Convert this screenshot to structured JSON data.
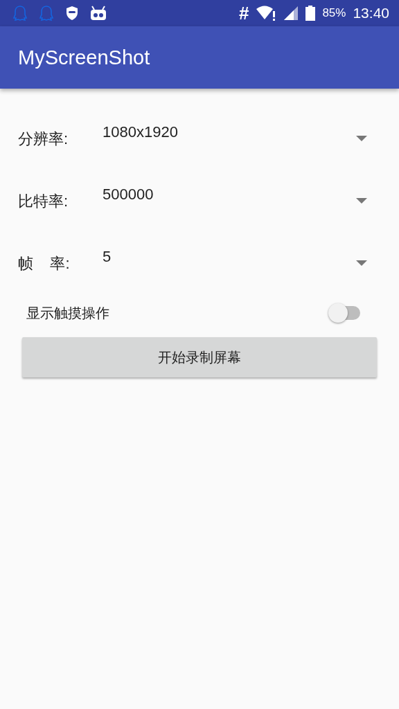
{
  "status_bar": {
    "hash": "#",
    "battery_text": "85%",
    "time": "13:40"
  },
  "app_bar": {
    "title": "MyScreenShot"
  },
  "settings": [
    {
      "label": "分辨率:",
      "value": "1080x1920"
    },
    {
      "label": "比特率:",
      "value": "500000"
    },
    {
      "label": "帧    率:",
      "value": "5"
    }
  ],
  "toggle": {
    "label": "显示触摸操作",
    "on": false
  },
  "button": {
    "label": "开始录制屏幕"
  }
}
